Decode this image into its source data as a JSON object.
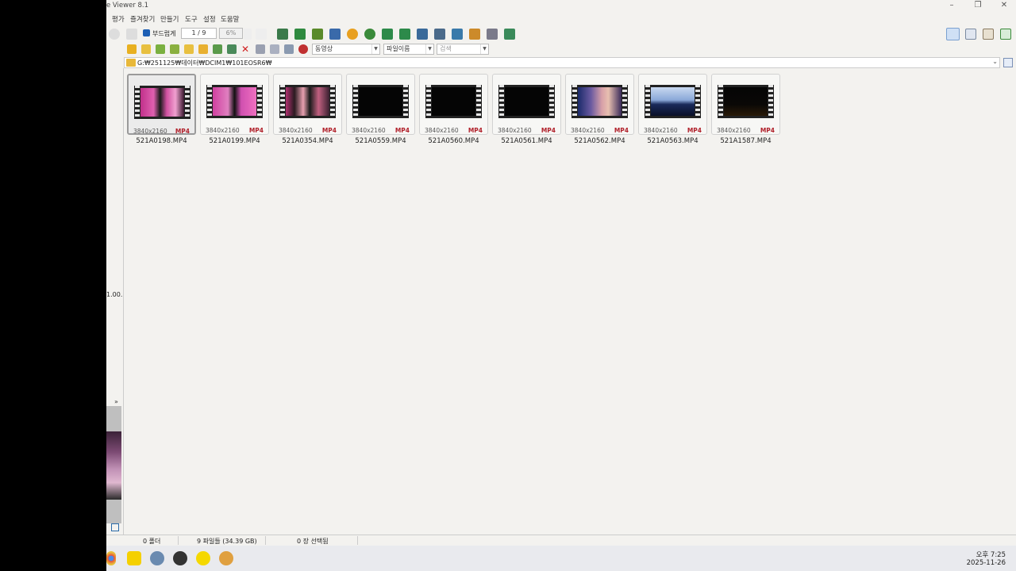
{
  "window": {
    "title": "e Viewer 8.1"
  },
  "menu": [
    "평가",
    "즐겨찾기",
    "만들기",
    "도구",
    "설정",
    "도움말"
  ],
  "toolbar": {
    "fit_label": "부드럽게",
    "page_counter": "1 / 9",
    "zoom": "6%"
  },
  "filters": {
    "type": "동영상",
    "sort": "파일이름",
    "search_placeholder": "검색"
  },
  "address": {
    "path": "G:₩251125₩데이터₩DCIM1₩101EOSR6₩"
  },
  "leftpane": {
    "version_fragment": "1.00."
  },
  "thumbnails": [
    {
      "name": "521A0198.MP4",
      "resolution": "3840x2160",
      "format": "MP4"
    },
    {
      "name": "521A0199.MP4",
      "resolution": "3840x2160",
      "format": "MP4"
    },
    {
      "name": "521A0354.MP4",
      "resolution": "3840x2160",
      "format": "MP4"
    },
    {
      "name": "521A0559.MP4",
      "resolution": "3840x2160",
      "format": "MP4"
    },
    {
      "name": "521A0560.MP4",
      "resolution": "3840x2160",
      "format": "MP4"
    },
    {
      "name": "521A0561.MP4",
      "resolution": "3840x2160",
      "format": "MP4"
    },
    {
      "name": "521A0562.MP4",
      "resolution": "3840x2160",
      "format": "MP4"
    },
    {
      "name": "521A0563.MP4",
      "resolution": "3840x2160",
      "format": "MP4"
    },
    {
      "name": "521A1587.MP4",
      "resolution": "3840x2160",
      "format": "MP4"
    }
  ],
  "status": {
    "folders": "0 폴더",
    "files": "9 파일들 (34.39 GB)",
    "selected": "0 장 선택됨"
  },
  "clock": {
    "time": "오후 7:25",
    "date": "2025-11-26"
  },
  "colors": {
    "accent": "#b0202a",
    "selection_border": "#9a9a9a",
    "folder": "#e8b83a"
  }
}
